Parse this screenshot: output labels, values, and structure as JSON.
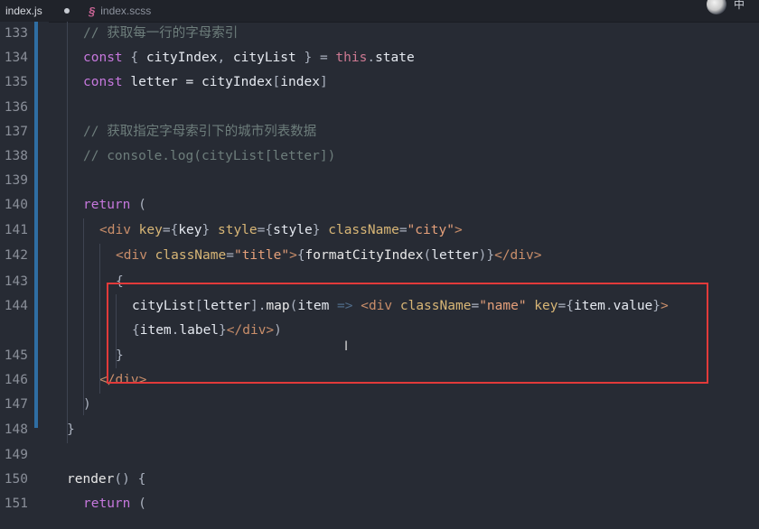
{
  "tabs": [
    {
      "label": "index.js",
      "active": true
    },
    {
      "label": "index.scss",
      "active": false
    }
  ],
  "header": {
    "corner_text": "中"
  },
  "lines": [
    {
      "num": "133",
      "tokens": [
        {
          "t": "// 获取每一行的字母索引",
          "c": "comment"
        }
      ]
    },
    {
      "num": "134",
      "tokens": [
        {
          "t": "const",
          "c": "kw"
        },
        {
          "t": " { ",
          "c": "punct"
        },
        {
          "t": "cityIndex",
          "c": "var"
        },
        {
          "t": ", ",
          "c": "punct"
        },
        {
          "t": "cityList",
          "c": "var"
        },
        {
          "t": " } = ",
          "c": "punct"
        },
        {
          "t": "this",
          "c": "this"
        },
        {
          "t": ".",
          "c": "punct"
        },
        {
          "t": "state",
          "c": "var"
        }
      ]
    },
    {
      "num": "135",
      "tokens": [
        {
          "t": "const",
          "c": "kw"
        },
        {
          "t": " letter = ",
          "c": "var"
        },
        {
          "t": "cityIndex",
          "c": "var"
        },
        {
          "t": "[",
          "c": "punct"
        },
        {
          "t": "index",
          "c": "var"
        },
        {
          "t": "]",
          "c": "punct"
        }
      ]
    },
    {
      "num": "136",
      "tokens": []
    },
    {
      "num": "137",
      "tokens": [
        {
          "t": "// 获取指定字母索引下的城市列表数据",
          "c": "comment"
        }
      ]
    },
    {
      "num": "138",
      "tokens": [
        {
          "t": "// console.log(cityList[letter])",
          "c": "comment"
        }
      ]
    },
    {
      "num": "139",
      "tokens": []
    },
    {
      "num": "140",
      "tokens": [
        {
          "t": "return",
          "c": "kw"
        },
        {
          "t": " (",
          "c": "punct"
        }
      ]
    },
    {
      "num": "141",
      "tokens": [
        {
          "t": "<div",
          "c": "tag"
        },
        {
          "t": " key",
          "c": "attr"
        },
        {
          "t": "={",
          "c": "punct"
        },
        {
          "t": "key",
          "c": "var"
        },
        {
          "t": "}",
          "c": "punct"
        },
        {
          "t": " style",
          "c": "attr"
        },
        {
          "t": "={",
          "c": "punct"
        },
        {
          "t": "style",
          "c": "var"
        },
        {
          "t": "}",
          "c": "punct"
        },
        {
          "t": " className",
          "c": "attr"
        },
        {
          "t": "=",
          "c": "punct"
        },
        {
          "t": "\"city\"",
          "c": "str"
        },
        {
          "t": ">",
          "c": "tag"
        }
      ]
    },
    {
      "num": "142",
      "tokens": [
        {
          "t": "<div",
          "c": "tag"
        },
        {
          "t": " className",
          "c": "attr"
        },
        {
          "t": "=",
          "c": "punct"
        },
        {
          "t": "\"title\"",
          "c": "str"
        },
        {
          "t": ">",
          "c": "tag"
        },
        {
          "t": "{",
          "c": "punct"
        },
        {
          "t": "formatCityIndex",
          "c": "fn"
        },
        {
          "t": "(",
          "c": "punct"
        },
        {
          "t": "letter",
          "c": "var"
        },
        {
          "t": ")}",
          "c": "punct"
        },
        {
          "t": "</div>",
          "c": "tag"
        }
      ]
    },
    {
      "num": "143",
      "tokens": [
        {
          "t": "{",
          "c": "punct"
        }
      ]
    },
    {
      "num": "144",
      "tokens": [
        {
          "t": "cityList",
          "c": "var"
        },
        {
          "t": "[",
          "c": "punct"
        },
        {
          "t": "letter",
          "c": "var"
        },
        {
          "t": "].",
          "c": "punct"
        },
        {
          "t": "map",
          "c": "fn"
        },
        {
          "t": "(",
          "c": "punct"
        },
        {
          "t": "item",
          "c": "var"
        },
        {
          "t": " => ",
          "c": "arrow"
        },
        {
          "t": "<div",
          "c": "tag"
        },
        {
          "t": " className",
          "c": "attr"
        },
        {
          "t": "=",
          "c": "punct"
        },
        {
          "t": "\"name\"",
          "c": "str"
        },
        {
          "t": " key",
          "c": "attr"
        },
        {
          "t": "={",
          "c": "punct"
        },
        {
          "t": "item",
          "c": "var"
        },
        {
          "t": ".",
          "c": "punct"
        },
        {
          "t": "value",
          "c": "var"
        },
        {
          "t": "}",
          "c": "punct"
        },
        {
          "t": ">",
          "c": "tag"
        }
      ]
    },
    {
      "num": "",
      "tokens": [
        {
          "t": "{",
          "c": "punct"
        },
        {
          "t": "item",
          "c": "var"
        },
        {
          "t": ".",
          "c": "punct"
        },
        {
          "t": "label",
          "c": "var"
        },
        {
          "t": "}",
          "c": "punct"
        },
        {
          "t": "</div>",
          "c": "tag"
        },
        {
          "t": ")",
          "c": "punct"
        }
      ]
    },
    {
      "num": "145",
      "tokens": [
        {
          "t": "}",
          "c": "punct"
        }
      ]
    },
    {
      "num": "146",
      "tokens": [
        {
          "t": "</div>",
          "c": "tag"
        }
      ]
    },
    {
      "num": "147",
      "tokens": [
        {
          "t": ")",
          "c": "punct"
        }
      ]
    },
    {
      "num": "148",
      "tokens": [
        {
          "t": "}",
          "c": "punct"
        }
      ]
    },
    {
      "num": "149",
      "tokens": []
    },
    {
      "num": "150",
      "tokens": [
        {
          "t": "render",
          "c": "fn"
        },
        {
          "t": "() {",
          "c": "punct"
        }
      ]
    },
    {
      "num": "151",
      "tokens": [
        {
          "t": "return",
          "c": "kw"
        },
        {
          "t": " (",
          "c": "punct"
        }
      ]
    }
  ],
  "colors": {
    "highlight_border": "#e23a3a",
    "git_bar": "#2f6ea3",
    "background": "#272b34"
  }
}
